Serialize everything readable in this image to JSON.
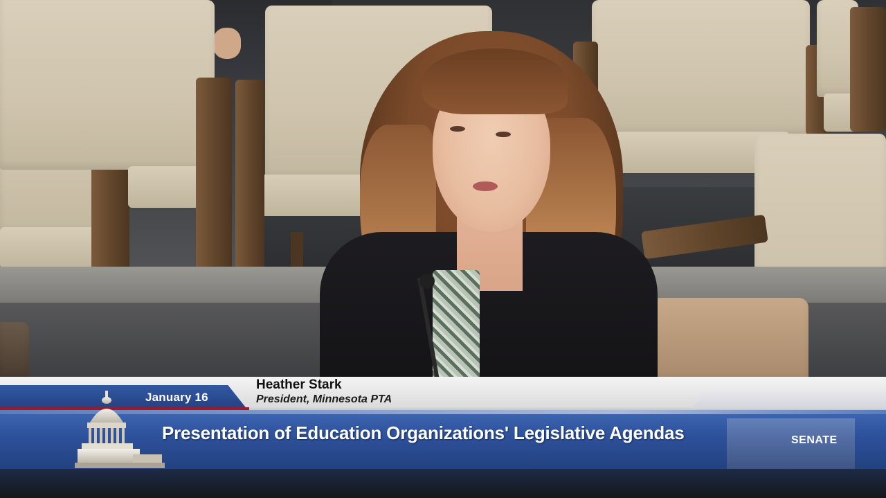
{
  "lower_third": {
    "date": "January 16",
    "speaker_name": "Heather Stark",
    "speaker_title": "President, Minnesota PTA",
    "program_title": "Presentation of Education Organizations' Legislative Agendas",
    "network_label": "SENATE"
  },
  "colors": {
    "banner_blue": "#2d519b",
    "date_tab_blue": "#233f80",
    "accent_red": "#9b1c24",
    "name_bar": "#ececec"
  },
  "icons": {
    "logo": "capitol-dome-icon"
  }
}
